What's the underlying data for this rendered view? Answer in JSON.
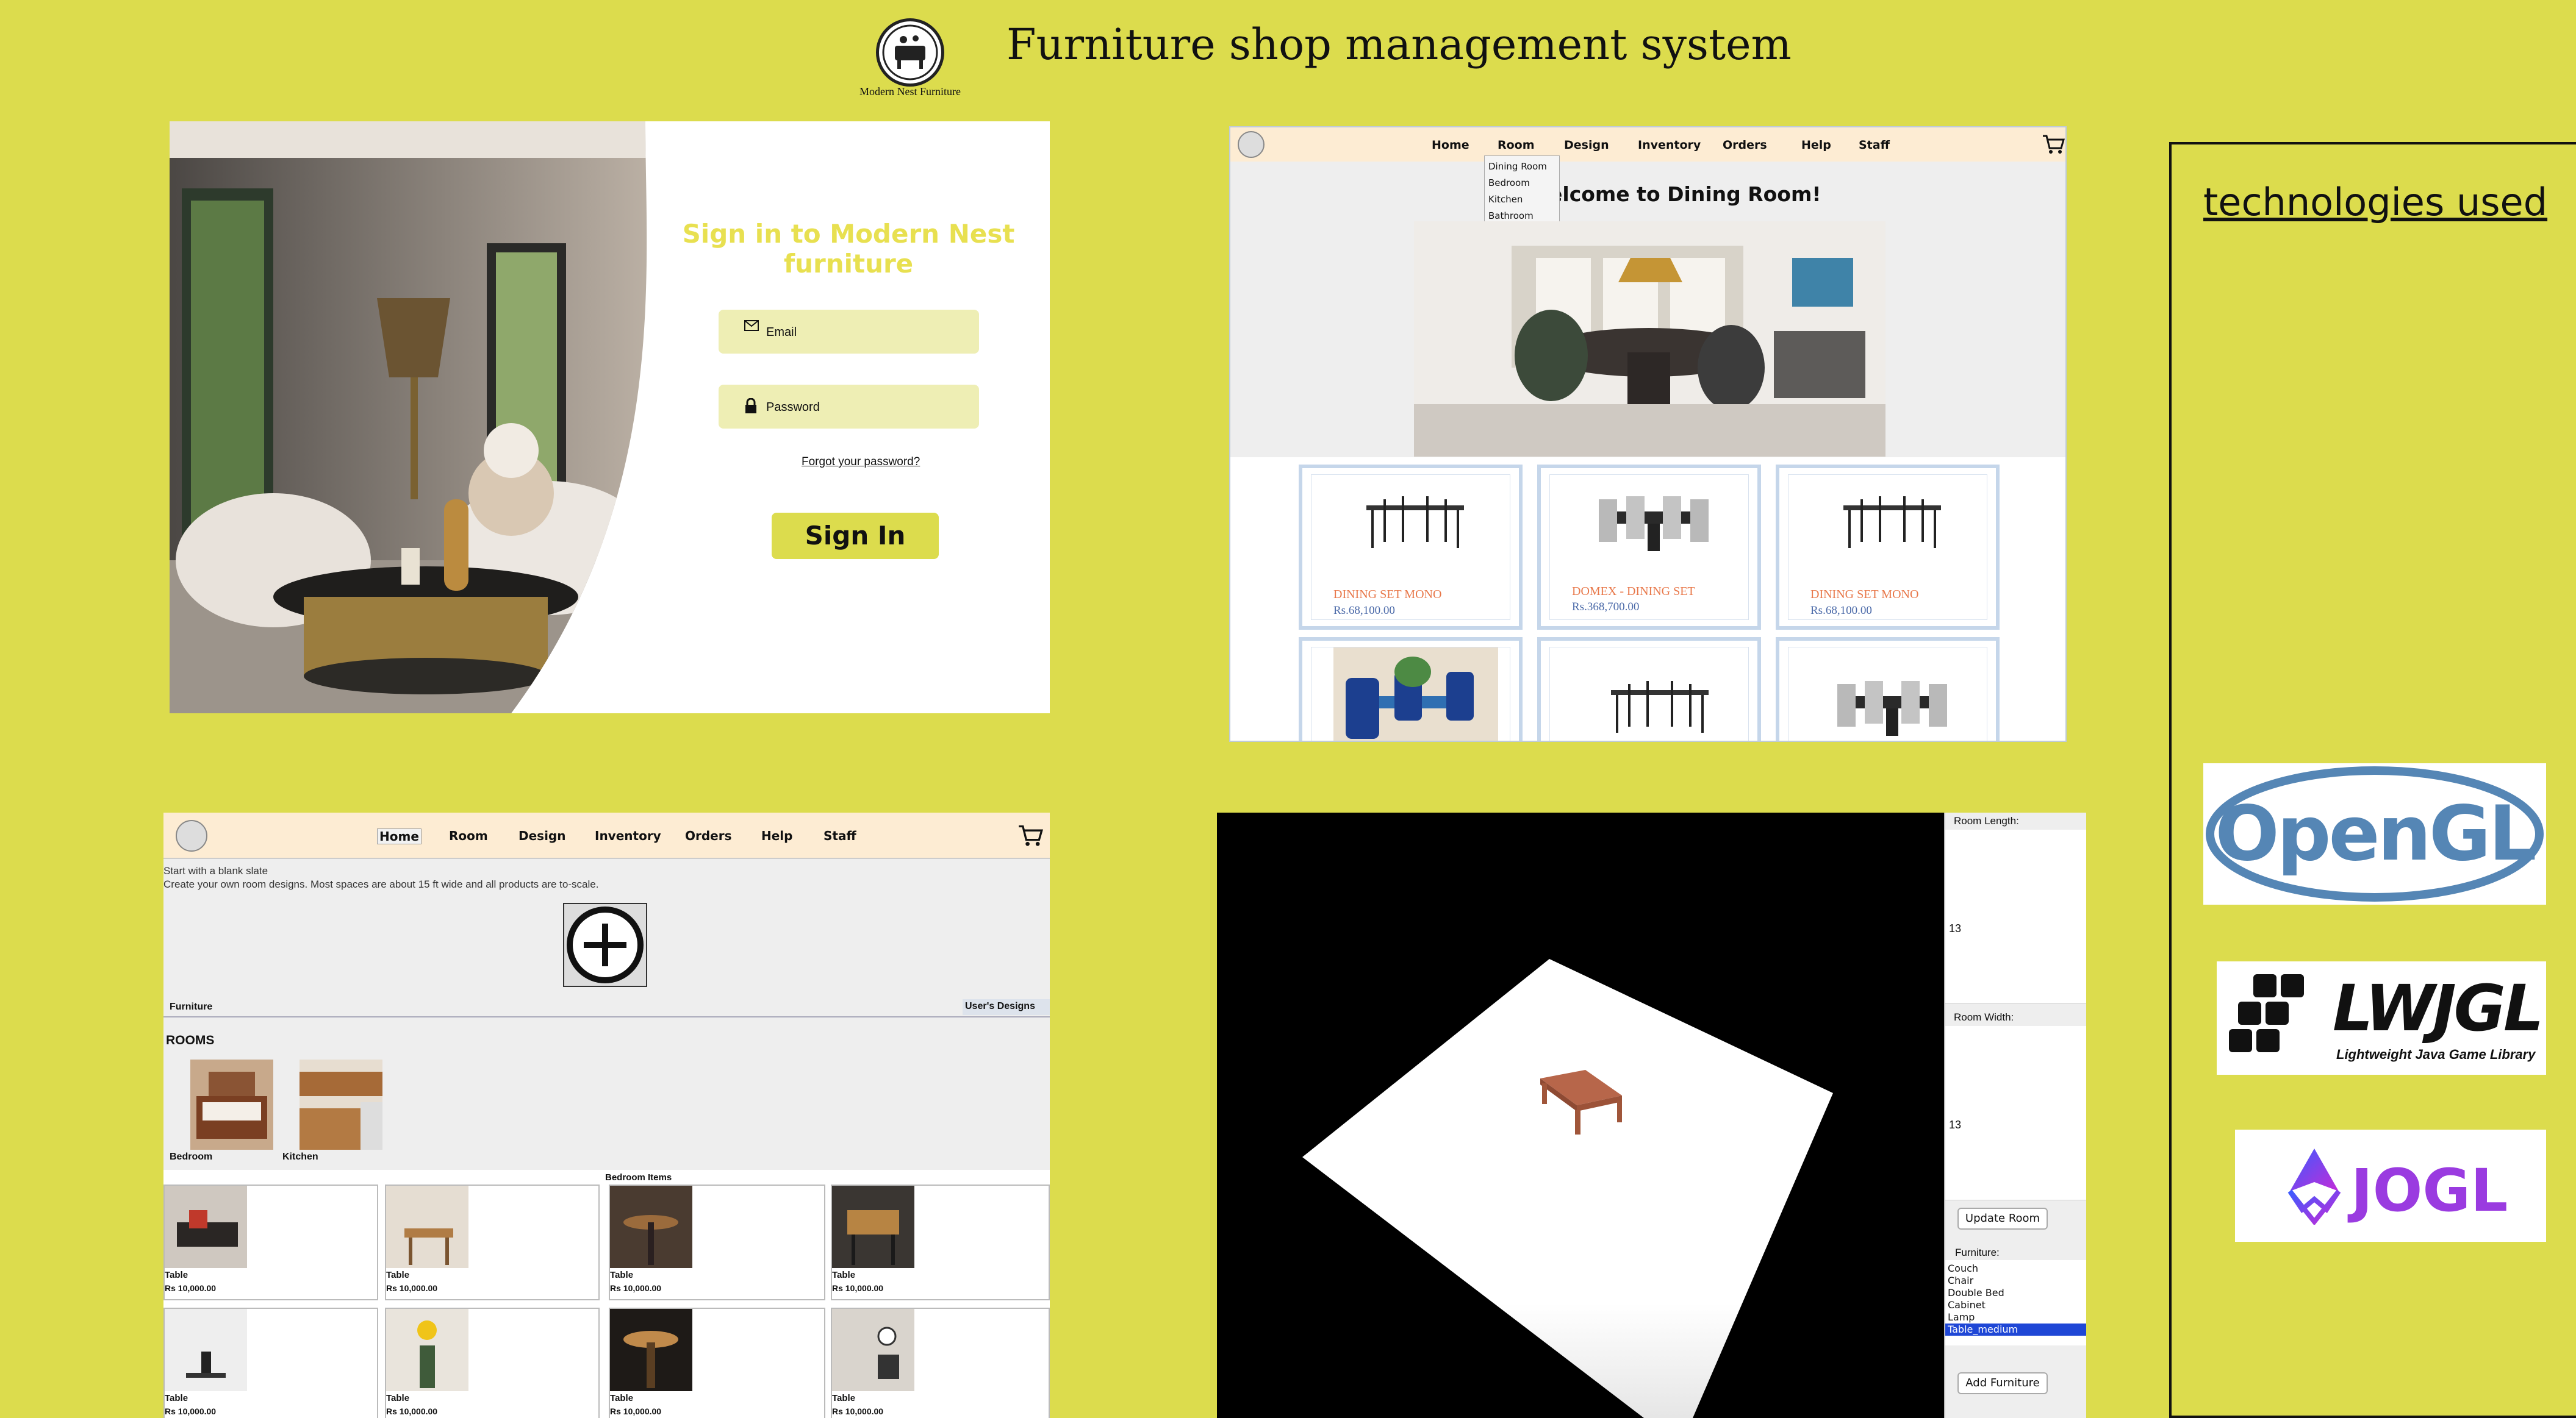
{
  "header": {
    "title": "Furniture shop management system",
    "logo_caption": "Modern Nest Furniture"
  },
  "login": {
    "heading": "Sign in to Modern Nest furniture",
    "email_placeholder": "Email",
    "password_placeholder": "Password",
    "forgot": "Forgot your password?",
    "sign_in": "Sign In"
  },
  "dining": {
    "nav": [
      "Home",
      "Room",
      "Design",
      "Inventory",
      "Orders",
      "Help",
      "Staff"
    ],
    "dropdown": [
      "Dining Room",
      "Bedroom",
      "Kitchen",
      "Bathroom"
    ],
    "welcome": "elcome to Dining Room!",
    "products": [
      {
        "name": "DINING SET MONO",
        "price": "Rs.68,100.00"
      },
      {
        "name": "DOMEX - DINING SET",
        "price": "Rs.368,700.00"
      },
      {
        "name": "DINING SET MONO",
        "price": "Rs.68,100.00"
      }
    ]
  },
  "design": {
    "nav": [
      "Home",
      "Room",
      "Design",
      "Inventory",
      "Orders",
      "Help",
      "Staff"
    ],
    "blank_title": "Start with a blank slate",
    "blank_desc": "Create your own room designs. Most spaces are about 15 ft wide and all products are to-scale.",
    "tab_furniture": "Furniture",
    "tab_users": "User's Designs",
    "rooms_heading": "ROOMS",
    "rooms": [
      "Bedroom",
      "Kitchen"
    ],
    "items_heading": "Bedroom Items",
    "items": [
      {
        "name": "Table",
        "price": "Rs 10,000.00"
      },
      {
        "name": "Table",
        "price": "Rs 10,000.00"
      },
      {
        "name": "Table",
        "price": "Rs 10,000.00"
      },
      {
        "name": "Table",
        "price": "Rs 10,000.00"
      },
      {
        "name": "Table",
        "price": "Rs 10,000.00"
      },
      {
        "name": "Table",
        "price": "Rs 10,000.00"
      },
      {
        "name": "Table",
        "price": "Rs 10,000.00"
      },
      {
        "name": "Table",
        "price": "Rs 10,000.00"
      }
    ]
  },
  "editor": {
    "room_length_label": "Room Length:",
    "room_length_value": "13",
    "room_width_label": "Room Width:",
    "room_width_value": "13",
    "update_button": "Update Room",
    "furniture_label": "Furniture:",
    "furniture_options": [
      "Couch",
      "Chair",
      "Double Bed",
      "Cabinet",
      "Lamp",
      "Table_medium"
    ],
    "selected_option": "Table_medium",
    "add_button": "Add Furniture"
  },
  "tech": {
    "heading": "technologies used",
    "items": [
      "OpenGL",
      "LWJGL",
      "Lightweight Java Game Library",
      "JOGL"
    ]
  },
  "colors": {
    "background": "#dcdc4d",
    "nav": "#fdecd3",
    "accent": "#e8e050",
    "selection": "#1f47d6"
  }
}
